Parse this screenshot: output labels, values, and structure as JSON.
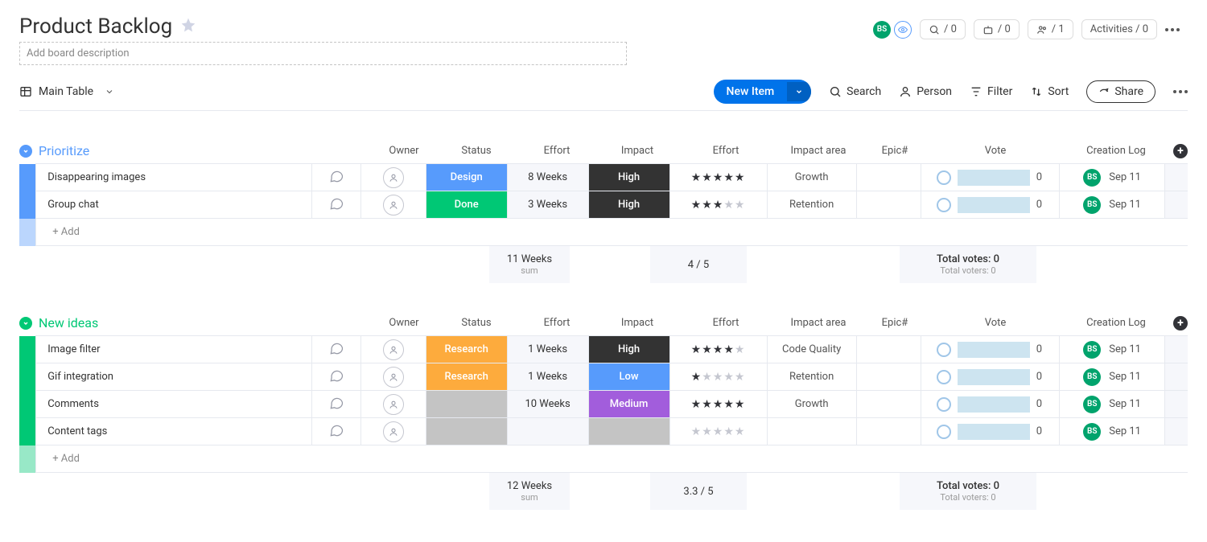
{
  "board": {
    "title": "Product Backlog",
    "desc_placeholder": "Add board description",
    "view_name": "Main Table",
    "avatar_initials": "BS"
  },
  "header_counts": {
    "integrations": "/ 0",
    "automations": "/ 0",
    "members": "/ 1",
    "activities_label": "Activities / 0"
  },
  "toolbar": {
    "new_item": "New Item",
    "search": "Search",
    "person": "Person",
    "filter": "Filter",
    "sort": "Sort",
    "share": "Share"
  },
  "columns": {
    "owner": "Owner",
    "status": "Status",
    "effort": "Effort",
    "impact": "Impact",
    "rating": "Effort",
    "area": "Impact area",
    "epic": "Epic#",
    "vote": "Vote",
    "log": "Creation Log"
  },
  "groups": [
    {
      "name": "Prioritize",
      "color": "#579bfc",
      "rows": [
        {
          "name": "Disappearing images",
          "status": "Design",
          "status_color": "#579bfc",
          "effort": "8 Weeks",
          "impact": "High",
          "impact_color": "#333333",
          "rating": 5,
          "area": "Growth",
          "vote": 0,
          "log": "Sep 11"
        },
        {
          "name": "Group chat",
          "status": "Done",
          "status_color": "#00c875",
          "effort": "3 Weeks",
          "impact": "High",
          "impact_color": "#333333",
          "rating": 3,
          "area": "Retention",
          "vote": 0,
          "log": "Sep 11"
        }
      ],
      "add_label": "+ Add",
      "summary": {
        "effort": "11 Weeks",
        "effort_sub": "sum",
        "rating": "4 / 5",
        "votes_l1": "Total votes: 0",
        "votes_l2": "Total voters: 0"
      }
    },
    {
      "name": "New ideas",
      "color": "#00c875",
      "rows": [
        {
          "name": "Image filter",
          "status": "Research",
          "status_color": "#fdab3d",
          "effort": "1 Weeks",
          "impact": "High",
          "impact_color": "#333333",
          "rating": 4,
          "area": "Code Quality",
          "vote": 0,
          "log": "Sep 11"
        },
        {
          "name": "Gif integration",
          "status": "Research",
          "status_color": "#fdab3d",
          "effort": "1 Weeks",
          "impact": "Low",
          "impact_color": "#579bfc",
          "rating": 1,
          "area": "Retention",
          "vote": 0,
          "log": "Sep 11"
        },
        {
          "name": "Comments",
          "status": "",
          "status_color": "#c4c4c4",
          "effort": "10 Weeks",
          "impact": "Medium",
          "impact_color": "#a25ddc",
          "rating": 5,
          "area": "Growth",
          "vote": 0,
          "log": "Sep 11"
        },
        {
          "name": "Content tags",
          "status": "",
          "status_color": "#c4c4c4",
          "effort": "",
          "impact": "",
          "impact_color": "#c4c4c4",
          "rating": 0,
          "area": "",
          "vote": 0,
          "log": "Sep 11"
        }
      ],
      "add_label": "+ Add",
      "summary": {
        "effort": "12 Weeks",
        "effort_sub": "sum",
        "rating": "3.3 / 5",
        "votes_l1": "Total votes: 0",
        "votes_l2": "Total voters: 0"
      }
    }
  ]
}
